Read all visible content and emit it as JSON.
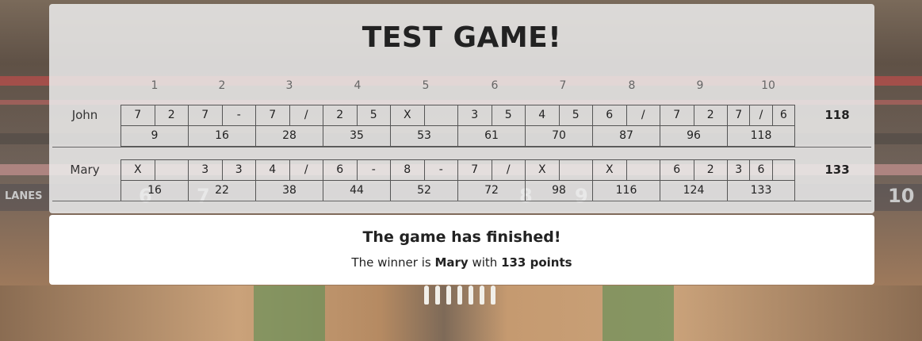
{
  "game": {
    "title": "TEST GAME!"
  },
  "background": {
    "sign_text": "LANES",
    "lane_numbers": [
      "6",
      "7",
      "8",
      "9",
      "10"
    ]
  },
  "frame_numbers": [
    "1",
    "2",
    "3",
    "4",
    "5",
    "6",
    "7",
    "8",
    "9",
    "10"
  ],
  "players": [
    {
      "name": "John",
      "total": "118",
      "frames": [
        {
          "rolls": [
            "7",
            "2"
          ],
          "score": "9"
        },
        {
          "rolls": [
            "7",
            "-"
          ],
          "score": "16"
        },
        {
          "rolls": [
            "7",
            "/"
          ],
          "score": "28"
        },
        {
          "rolls": [
            "2",
            "5"
          ],
          "score": "35"
        },
        {
          "rolls": [
            "X",
            ""
          ],
          "score": "53"
        },
        {
          "rolls": [
            "3",
            "5"
          ],
          "score": "61"
        },
        {
          "rolls": [
            "4",
            "5"
          ],
          "score": "70"
        },
        {
          "rolls": [
            "6",
            "/"
          ],
          "score": "87"
        },
        {
          "rolls": [
            "7",
            "2"
          ],
          "score": "96"
        },
        {
          "rolls": [
            "7",
            "/",
            "6"
          ],
          "score": "118"
        }
      ]
    },
    {
      "name": "Mary",
      "total": "133",
      "frames": [
        {
          "rolls": [
            "X",
            ""
          ],
          "score": "16"
        },
        {
          "rolls": [
            "3",
            "3"
          ],
          "score": "22"
        },
        {
          "rolls": [
            "4",
            "/"
          ],
          "score": "38"
        },
        {
          "rolls": [
            "6",
            "-"
          ],
          "score": "44"
        },
        {
          "rolls": [
            "8",
            "-"
          ],
          "score": "52"
        },
        {
          "rolls": [
            "7",
            "/"
          ],
          "score": "72"
        },
        {
          "rolls": [
            "X",
            ""
          ],
          "score": "98"
        },
        {
          "rolls": [
            "X",
            ""
          ],
          "score": "116"
        },
        {
          "rolls": [
            "6",
            "2"
          ],
          "score": "124"
        },
        {
          "rolls": [
            "3",
            "6",
            ""
          ],
          "score": "133"
        }
      ]
    }
  ],
  "result": {
    "title": "The game has finished!",
    "prefix": "The winner is ",
    "winner": "Mary",
    "middle": " with ",
    "points": "133 points"
  }
}
